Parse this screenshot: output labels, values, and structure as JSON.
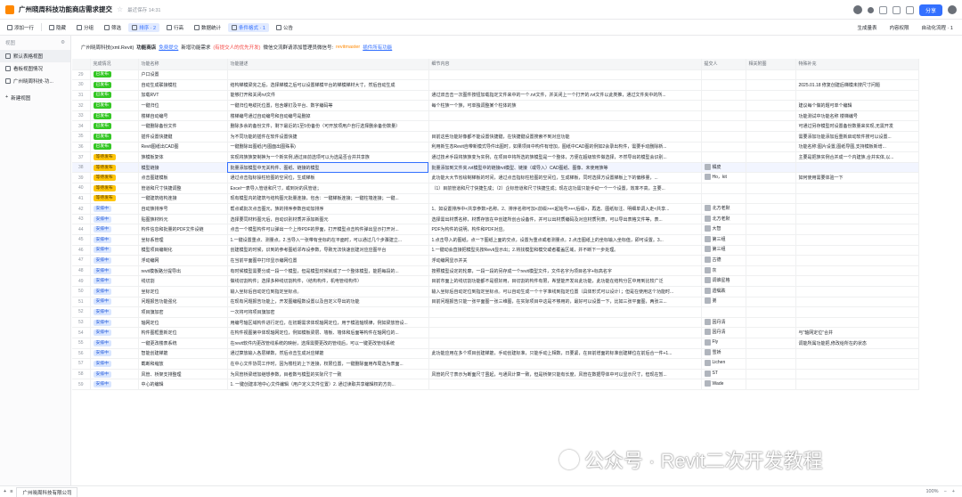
{
  "header": {
    "title": "广州晓周科技功能商店需求提交",
    "saved": "最近保存 14:31",
    "share": "分享"
  },
  "toolbar": {
    "add_record": "添加一行",
    "fields": "隐藏",
    "group": "分组",
    "filter": "筛选",
    "sort": "排序 · 2",
    "row_height": "行高",
    "data_table": "数据统计",
    "formula": "条件格式 · 1",
    "notice": "公告",
    "right": [
      "生成量表",
      "内容权限",
      "自动化流程 · 1"
    ]
  },
  "sidebar": {
    "head": "视图",
    "items": [
      "默认表格视图",
      "看板视图情况",
      "广州晓周科技-功..."
    ],
    "new": "新建视图"
  },
  "banner": {
    "p1": "广州晓周科技(xml.Revit)",
    "p2": "功能商店",
    "p3": "免费提交",
    "p4": "新增功能需求",
    "p5": "(有提交人的优先开发)",
    "p6": "微信交流群请添加管理员微信号:",
    "p7": "revitmaster",
    "p8": "插件所有功能"
  },
  "columns": [
    "",
    "完成情况",
    "功能名称",
    "功能描述",
    "细节内容",
    "提交人",
    "相关附图",
    "特殊补充"
  ],
  "rows": [
    {
      "n": "29",
      "s": "已发布",
      "st": "g",
      "name": "户口设置",
      "desc": "",
      "detail": "",
      "who": "",
      "note": ""
    },
    {
      "n": "30",
      "s": "已发布",
      "st": "g",
      "name": "自动生成联接模柱",
      "desc": "结构梯模梁完之后，选择梯模之后可以设置梯模平台的梯模梯材大寸，然后自动生成",
      "detail": "",
      "who": "",
      "note": "2025.01.18 修复创建后梯模未搜尺寸问题"
    },
    {
      "n": "31",
      "s": "已发布",
      "st": "g",
      "name": "加载RVT",
      "desc": "能够打开和关闭rvt文件",
      "detail": "通过双击击一次图件按钮加载指定文件来中的一个.rvt文件，并关闭上一个打开的.rvt文件以此类推，通过文件夹中的所...",
      "who": "",
      "note": ""
    },
    {
      "n": "32",
      "s": "已发布",
      "st": "g",
      "name": "一键归位",
      "desc": "一键归位电缆托位置，包含螺钉及平台、数字编码等",
      "detail": "每个柱族一个族，可单独调整某个柱体的族",
      "who": "",
      "note": "建议每个做的题可单个编辑"
    },
    {
      "n": "33",
      "s": "已发布",
      "st": "g",
      "name": "楼梯自动编号",
      "desc": "楼梯编号通过自动编号和自动编号是删掉",
      "detail": "",
      "who": "",
      "note": "功能测试中功能名称 楼梯编号"
    },
    {
      "n": "34",
      "s": "已发布",
      "st": "g",
      "name": "一键删除备份文件",
      "desc": "删除多余的备份文件，剩下最近的1至5份备份（可开放项用户自行选择删余备份数量）",
      "detail": "",
      "who": "",
      "note": "可通过另存模型时设置备份数量来实现,无需开发"
    },
    {
      "n": "35",
      "s": "已发布",
      "st": "g",
      "name": "插件设置快捷键",
      "desc": "为不同功能的插件在软件设置快捷",
      "detail": "目前这些功能好像都不能设置快捷键，在快捷键设置搜索不到对应功能",
      "who": "",
      "note": "需要添加功能添加后重新启动软件搜可以设置..."
    },
    {
      "n": "36",
      "s": "已发布",
      "st": "g",
      "name": "Revit图纸出CAD图",
      "desc": "一键删除出图纸(与图面出图殊事)",
      "detail": "利用新生态Revit自带新模式导件出图时，如果项目中构件有增加，图纸中CAD图的例如2会录出构件，需要手动删除新...",
      "who": "",
      "note": "功能名称:图片设置,图纸导图,支持模板新增..."
    },
    {
      "n": "37",
      "s": "等待发布",
      "st": "y",
      "name": "族模板复体",
      "desc": "实现将族族复制换为一个新实例,通过目前选项可以为选是否合并共享族",
      "detail": "通过技术手段将族族变为实例，在项目中将所选的族模型是一个整体，方便在超级软件做选择，不然导出的模型会识别...",
      "who": "",
      "note": "主要是把族实例合并成一个内建族,合并实体,以..."
    },
    {
      "n": "38",
      "s": "等待发布",
      "st": "y",
      "name": "模型链接",
      "desc": "批量添加模型中无关构件、图纸、链接的模型",
      "detail": "批量添加到文件夹.rvt模型中的链接rvt模型、链接（或导入）CAD图纸、图像、未使用族等",
      "who": "橘皮",
      "note": ""
    },
    {
      "n": "39",
      "s": "等待发布",
      "st": "y",
      "name": "点击图建模板",
      "desc": "通过点击指标操柱检图的空间位，生成梯板",
      "detail": "此功能大大节省绘制梯板的时间，通过点击指标柱检图的空间位，生成梯板，同时选择方设置梯板上下的偏移量，...",
      "who": "Ho，kit",
      "note": "如何使用需要体验一下"
    },
    {
      "n": "40",
      "s": "等待发布",
      "st": "y",
      "name": "管道和尺寸快捷调整",
      "desc": "Excel一表导入管道和尺寸，或到对的风管道；",
      "detail": "（1）目前管道和尺寸快捷生成；（2）企标管道和尺寸快捷生成；现在这功需只能手动一个一个设置，效率不高，主要...",
      "who": "",
      "note": ""
    },
    {
      "n": "41",
      "s": "等待发布",
      "st": "y",
      "name": "一键建筑结构连接",
      "desc": "现有模型内的建筑与结构图元批量连接，包含：一键梯板连接；一键柱墙连接；一键...",
      "detail": "",
      "who": "",
      "note": ""
    },
    {
      "n": "42",
      "s": "安排中",
      "st": "b",
      "name": "自动族排序号",
      "desc": "帮点或批次点击图元，族的排序参数自动加排序",
      "detail": "1、如设置排序中<共享参数>名称。2、排序名称可加<前缀>+<起始号>+<后缀>，再选、图纸标注、明细单调入走<共享...",
      "who": "北方老默",
      "note": ""
    },
    {
      "n": "43",
      "s": "安排中",
      "st": "b",
      "name": "贴图族材料元",
      "desc": "选择要同材料图元后，自动识别材质并添加新图元",
      "detail": "选择需出材质名称，材质存放在中创建所创合设备件，并可以出材质编码及对应材质列表，可以导出表格文件等，表...",
      "who": "北方老默",
      "note": ""
    },
    {
      "n": "44",
      "s": "安排中",
      "st": "b",
      "name": "构件信息和批量的PDF文件设链",
      "desc": "点击一个模型构件可以弹出一个上传PDF的界面，打开模型点击构件弹出显示打开对...",
      "detail": "PDF为构件的说明，构件和PDF对应。",
      "who": "大智",
      "note": ""
    },
    {
      "n": "45",
      "s": "安排中",
      "st": "b",
      "name": "坐标系管理",
      "desc": "1.一键设置重点、测量点。2.当导入一张带有坐标的在平面时，可以通过几个步骤建立...",
      "detail": "1.点击导入的图纸，点一下图纸上面的交点，设置为重点或者测量点。2.点击图纸上的坐标输入坐标值，即可设置。3...",
      "who": "第三组",
      "note": ""
    },
    {
      "n": "46",
      "s": "安排中",
      "st": "b",
      "name": "模型项目编制化",
      "desc": "创建模型的时候，识到的参考图纸邻布设参数，导致无法快速创建对应应图平台",
      "detail": "1.一键动会直接把模型先按Revit显示出；2.将找模型和模交或者覆盖区域，并不断下一步处理。",
      "who": "第三组",
      "note": ""
    },
    {
      "n": "47",
      "s": "安排中",
      "st": "b",
      "name": "浮动编网",
      "desc": "在当前平面图中打印显示编网位置",
      "detail": "浮动编网显示并关",
      "who": "古德",
      "note": ""
    },
    {
      "n": "48",
      "s": "安排中",
      "st": "b",
      "name": "revit模板路分提导出",
      "desc": "有时候模型需要分成一段一个模型，但是模型时候就成了一个整体模型，能把每段的...",
      "detail": "按照模型设定的轮廓，一段一段的另存成一个revit模型文件，文件名字为项目名字+标高名字",
      "who": "灰",
      "note": ""
    },
    {
      "n": "49",
      "s": "安排中",
      "st": "b",
      "name": "线切割",
      "desc": "做线切割构件；选择多种线切割构件，（结构构件，机电管线构件）",
      "detail": "目前市面上的线切割功能都不是很好用，目切割的构件有限，希望能开发出此功能，此功能在结构分区中用到比较广泛",
      "who": "调谁星格",
      "note": ""
    },
    {
      "n": "50",
      "s": "安排中",
      "st": "b",
      "name": "坐标定位",
      "desc": "输入坐标后自动定位到指定坐标点。",
      "detail": "输入坐标后自动定位到指定坐标点。可以自动生成一个十字准线到指定位置（具体形式可以设计）；但是在使用这个功能时...",
      "who": "遗嘱跌",
      "note": ""
    },
    {
      "n": "51",
      "s": "安排中",
      "st": "b",
      "name": "问题报告功能强化",
      "desc": "在现有问题报告功能上，开发图编程数设置以及自定义导出的功能",
      "detail": "目前问题报告只能一张平面图一张三维图，在实际项目中这是不够用的，最好可以设置一下，比如三张平面图，两张三...",
      "who": "弟",
      "note": ""
    },
    {
      "n": "52",
      "s": "安排中",
      "st": "b",
      "name": "项目旗加密",
      "desc": "一次将可将项目旗加密",
      "detail": "",
      "who": "",
      "note": ""
    },
    {
      "n": "53",
      "s": "安排中",
      "st": "b",
      "name": "轴网定位",
      "desc": "用编号轴区域构件进行定位，在初期需求体现轴网定位，用于模验轴规律，例如梁放管设...",
      "detail": "",
      "who": "因丹清",
      "note": ""
    },
    {
      "n": "54",
      "s": "安排中",
      "st": "b",
      "name": "构件图框重新定位",
      "desc": "在构件视图第中体现轴网定位，例如模板梁层、墙板、墙体和后面等构件在轴网位的...",
      "detail": "",
      "who": "因丹清",
      "note": "与\"轴网定位\"合并"
    },
    {
      "n": "55",
      "s": "安排中",
      "st": "b",
      "name": "一键更改楼表系统",
      "desc": "在revit软件内更改管线系统的映射，选择需要更改的管线后，可以一键更改管线系统",
      "detail": "",
      "who": "Fly",
      "note": "调能所属功能把,修改给所在的状态"
    },
    {
      "n": "56",
      "s": "安排中",
      "st": "b",
      "name": "智能创建梯筋",
      "desc": "通过算放输入各层梯数，然后点击生成对应梯筋",
      "detail": "此功能应用在多个项目创建梯筋，手动创建标准，只能手动上相数，日要紧，在目前增面的标准创建梯位在前后合一件+1...",
      "who": "雪娇",
      "note": ""
    },
    {
      "n": "57",
      "s": "安排中",
      "st": "b",
      "name": "截断和缩放",
      "desc": "在中心文件协同工作时，因为楼柱的上下连接，权限位置，一键删除面用布局选为表面...",
      "detail": "",
      "who": "Lichen",
      "note": ""
    },
    {
      "n": "58",
      "s": "安排中",
      "st": "b",
      "name": "风管、桥架支排整理",
      "desc": "为风管桥梁增加继想参数，目者数与模型的实际尺寸一致",
      "detail": "风管的尺寸表示为断面尺寸虽起，与通风计算一致，但是桥架只能有长度，风管在数据导体中可以显示尺寸，但现在暂...",
      "who": "ST",
      "note": ""
    },
    {
      "n": "59",
      "s": "安排中",
      "st": "b",
      "name": "中心的编辑",
      "desc": "1. 一键创建本地中心文件编辑（用户定义文件位置）2. 通过读取共享编辑权的方向...",
      "detail": "",
      "who": "Wade",
      "note": ""
    }
  ],
  "sheet": {
    "name": "广州晓周科技有限公司",
    "zoom": "100%"
  },
  "watermark": "公众号 · Revit二次开发教程"
}
